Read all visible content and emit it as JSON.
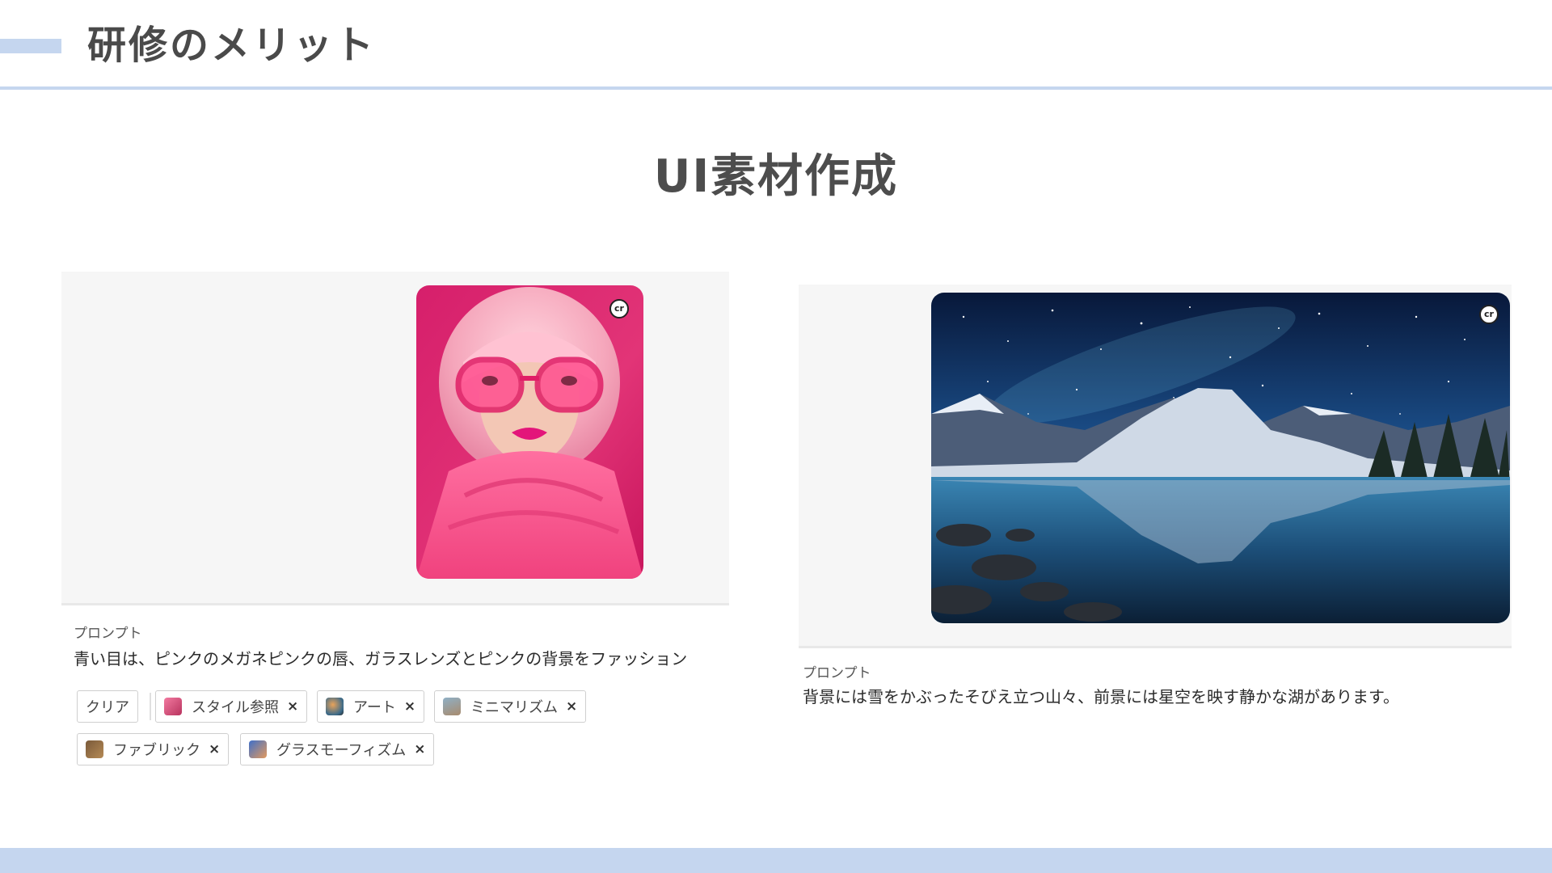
{
  "header": {
    "title": "研修のメリット"
  },
  "section": {
    "title": "UI素材作成"
  },
  "left_example": {
    "badge": "cr",
    "prompt_label": "プロンプト",
    "prompt_text": "青い目は、ピンクのメガネピンクの唇、ガラスレンズとピンクの背景をファッション",
    "chips": {
      "clear": "クリア",
      "style_reference": "スタイル参照",
      "art": "アート",
      "minimalism": "ミニマリズム",
      "fabric": "ファブリック",
      "glassmorphism": "グラスモーフィズム"
    },
    "remove_glyph": "×"
  },
  "right_example": {
    "badge": "cr",
    "prompt_label": "プロンプト",
    "prompt_text": "背景には雪をかぶったそびえ立つ山々、前景には星空を映す静かな湖があります。"
  },
  "colors": {
    "accent": "#c5d6ef",
    "panel": "#f6f6f6",
    "heading": "#4a4a4a"
  }
}
